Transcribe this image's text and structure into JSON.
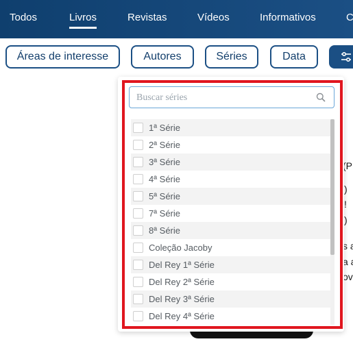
{
  "nav": {
    "tabs": [
      {
        "label": "Todos"
      },
      {
        "label": "Livros"
      },
      {
        "label": "Revistas"
      },
      {
        "label": "Vídeos"
      },
      {
        "label": "Informativos"
      },
      {
        "label": "C"
      }
    ],
    "active_tab": "Livros"
  },
  "filters": {
    "areas": "Áreas de interesse",
    "autores": "Autores",
    "series": "Séries",
    "data": "Data",
    "settings_icon": "sliders-icon"
  },
  "dropdown": {
    "search_placeholder": "Buscar séries",
    "items": [
      {
        "label": "1ª Série"
      },
      {
        "label": "2ª Série"
      },
      {
        "label": "3ª Série"
      },
      {
        "label": "4ª Série"
      },
      {
        "label": "5ª Série"
      },
      {
        "label": "7ª Série"
      },
      {
        "label": "8ª Série"
      },
      {
        "label": "Coleção Jacoby"
      },
      {
        "label": "Del Rey 1ª Série"
      },
      {
        "label": "Del Rey 2ª Série"
      },
      {
        "label": "Del Rey 3ª Série"
      },
      {
        "label": "Del Rey 4ª Série"
      }
    ]
  },
  "background": {
    "fragments": [
      "(P",
      ")",
      "ǃ",
      ")",
      "s a",
      "a a",
      "ov"
    ]
  },
  "colors": {
    "nav_bg": "#1b4f84",
    "accent": "#1b4f84",
    "highlight": "#e0161f"
  }
}
